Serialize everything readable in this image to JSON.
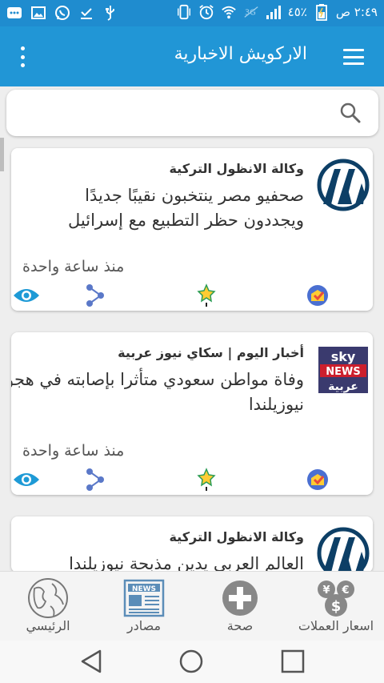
{
  "status_bar": {
    "time": "٢:٤٩ ص",
    "battery": "٤٥٪"
  },
  "app_bar": {
    "title": "الاركويش الاخبارية"
  },
  "search": {
    "placeholder": ""
  },
  "articles": [
    {
      "source": "وكالة الانظول التركية",
      "headline": "صحفيو مصر ينتخبون نقيبًا جديدًا ويجددون حظر التطبيع مع إسرائيل",
      "time": "منذ ساعة واحدة",
      "logo": "aa-logo"
    },
    {
      "source": "أخبار اليوم | سكاي نيوز عربية",
      "headline": "وفاة مواطن سعودي متأثرا بإصابته في هجوم نيوزيلندا",
      "time": "منذ ساعة واحدة",
      "logo": "sky-news-logo",
      "logo_text": [
        "sky",
        "NEWS",
        "عربية"
      ]
    },
    {
      "source": "وكالة الانظول التركية",
      "headline": "العالم العربي يدين مذبحة نيوزيلندا",
      "time": "",
      "logo": "aa-logo"
    }
  ],
  "bottom_nav": [
    {
      "label": "الرئيسي",
      "icon": "globe-icon"
    },
    {
      "label": "مصادر",
      "icon": "news-icon",
      "icon_text": "NEWS"
    },
    {
      "label": "صحة",
      "icon": "health-plus-icon"
    },
    {
      "label": "اسعار العملات",
      "icon": "currency-icon"
    }
  ],
  "colors": {
    "status_bar": "#1f8ccf",
    "app_bar": "#2196d6",
    "aa_logo": "#0d3f66",
    "eye_icon": "#1e9ad6",
    "share_icon": "#5a78c8"
  }
}
